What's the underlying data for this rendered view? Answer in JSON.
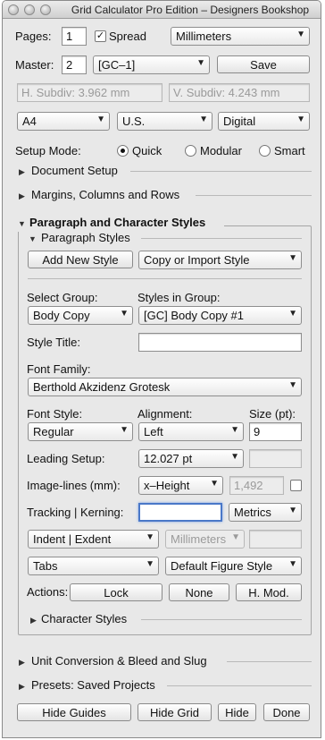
{
  "window": {
    "title": "Grid Calculator Pro Edition – Designers Bookshop"
  },
  "pages": {
    "label": "Pages:",
    "value": "1",
    "spread_label": "Spread",
    "spread_checked": "✓",
    "units": "Millimeters"
  },
  "master": {
    "label": "Master:",
    "value": "2",
    "select": "[GC–1]",
    "save_label": "Save"
  },
  "subdiv": {
    "h_placeholder": "H. Subdiv: 3.962 mm",
    "v_placeholder": "V. Subdiv: 4.243 mm"
  },
  "format": {
    "size": "A4",
    "region": "U.S.",
    "output": "Digital"
  },
  "setup": {
    "label": "Setup Mode:",
    "quick": "Quick",
    "modular": "Modular",
    "smart": "Smart"
  },
  "sections": {
    "document_setup": "Document Setup",
    "margins": "Margins, Columns and Rows",
    "para_char": "Paragraph and Character Styles",
    "paragraph_styles": "Paragraph Styles",
    "character_styles": "Character Styles",
    "unit_conversion": "Unit Conversion & Bleed and Slug",
    "presets": "Presets: Saved Projects"
  },
  "styles": {
    "add_new": "Add New Style",
    "copy_import": "Copy or Import Style",
    "select_group_label": "Select Group:",
    "select_group": "Body Copy",
    "styles_in_group_label": "Styles in Group:",
    "styles_in_group": "[GC] Body Copy #1",
    "style_title_label": "Style Title:",
    "style_title": "",
    "font_family_label": "Font Family:",
    "font_family": "Berthold Akzidenz Grotesk",
    "font_style_label": "Font Style:",
    "font_style": "Regular",
    "alignment_label": "Alignment:",
    "alignment": "Left",
    "size_label": "Size (pt):",
    "size": "9",
    "leading_label": "Leading Setup:",
    "leading": "12.027 pt",
    "image_lines_label": "Image-lines (mm):",
    "image_lines": "x–Height",
    "image_lines_value": "1,492",
    "tracking_label": "Tracking | Kerning:",
    "tracking_value": "",
    "kerning": "Metrics",
    "indent": "Indent | Exdent",
    "indent_units": "Millimeters",
    "tabs": "Tabs",
    "figure_style": "Default Figure Style",
    "actions_label": "Actions:",
    "lock": "Lock",
    "none": "None",
    "hmod": "H. Mod."
  },
  "footer": {
    "hide_guides": "Hide Guides",
    "hide_grid": "Hide Grid",
    "hide": "Hide",
    "done": "Done"
  }
}
